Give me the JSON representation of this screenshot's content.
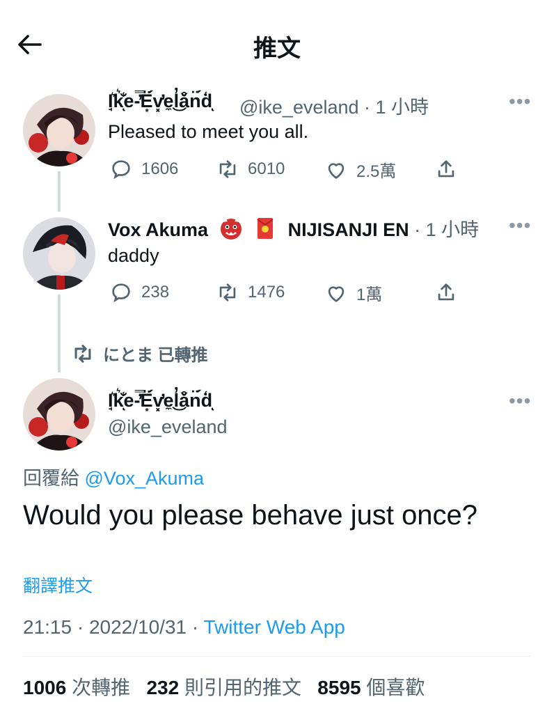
{
  "header": {
    "title": "推文"
  },
  "thread": [
    {
      "display_name": "I̘͛k͛̆̾ͅe-̓̿Ë͙́v͓̓e̼͜l̓å̌n̈́ḋ̾ͅ",
      "handle": "@ike_eveland",
      "time": "· 1 小時",
      "text": "Pleased to meet you all.",
      "replies": "1606",
      "retweets": "6010",
      "likes": "2.5萬"
    },
    {
      "display_name": "Vox Akuma",
      "display_name_suffix": "NIJISANJI EN",
      "time": "· 1 小時",
      "text": "daddy",
      "replies": "238",
      "retweets": "1476",
      "likes": "1萬"
    }
  ],
  "retweeted_by": "にとま 已轉推",
  "main": {
    "display_name": "I̘͛k͛̆̾ͅe-̓̿Ë͙́v͓̓e̼͜l̓å̌n̈́ḋ̾ͅ",
    "handle": "@ike_eveland",
    "reply_prefix": "回覆給",
    "reply_to": "@Vox_Akuma",
    "text": "Would you please behave just once?",
    "translate": "翻譯推文",
    "datetime": "21:15 · 2022/10/31 ·",
    "source": "Twitter Web App"
  },
  "stats": {
    "retweets": "1006",
    "retweets_label": "次轉推",
    "quotes": "232",
    "quotes_label": "則引用的推文",
    "likes": "8595",
    "likes_label": "個喜歡"
  },
  "colors": {
    "accent": "#1d9bf0",
    "muted": "#536471",
    "text": "#0f1419"
  }
}
